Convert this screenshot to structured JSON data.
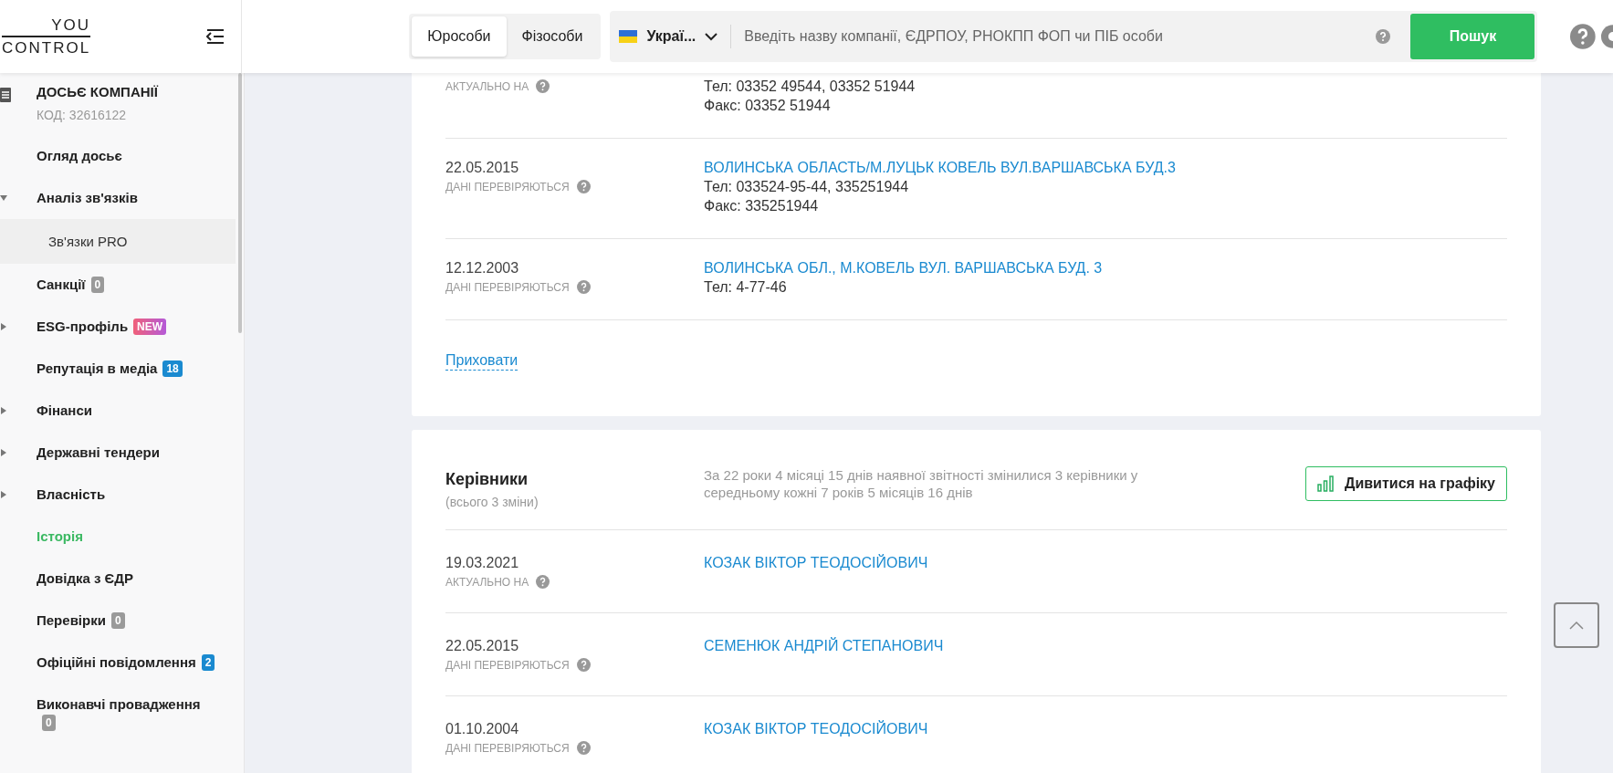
{
  "header": {
    "logo": {
      "top": "YOU",
      "bottom": "CONTROL"
    },
    "tabs": [
      {
        "label": "Юрособи",
        "selected": true
      },
      {
        "label": "Фізособи",
        "selected": false
      }
    ],
    "country": "Украї...",
    "search": {
      "placeholder": "Введіть назву компанії, ЄДРПОУ, РНОКПП ФОП чи ПІБ особи"
    },
    "search_button": "Пошук"
  },
  "sidebar": {
    "title": "ДОСЬЄ КОМПАНІЇ",
    "code": "КОД: 32616122",
    "items": [
      {
        "label": "Огляд досьє",
        "selected": false
      },
      {
        "label": "Аналіз зв'язків",
        "selected": false,
        "expanded": true,
        "children": [
          {
            "label": "Зв'язки PRO",
            "selected": false,
            "hovered": true
          }
        ]
      },
      {
        "label": "Санкції",
        "selected": false,
        "badge": {
          "text": "0",
          "kind": "neutral"
        }
      },
      {
        "label": "ESG-профіль",
        "selected": false,
        "expanded": false,
        "badge": {
          "text": "NEW",
          "kind": "new"
        }
      },
      {
        "label": "Репутація в медіа",
        "selected": false,
        "badge": {
          "text": "18",
          "kind": "info"
        }
      },
      {
        "label": "Фінанси",
        "selected": false,
        "expanded": false
      },
      {
        "label": "Державні тендери",
        "selected": false,
        "expanded": false
      },
      {
        "label": "Власність",
        "selected": false,
        "expanded": false
      },
      {
        "label": "Історія",
        "selected": true
      },
      {
        "label": "Довідка з ЄДР",
        "selected": false
      },
      {
        "label": "Перевірки",
        "selected": false,
        "badge": {
          "text": "0",
          "kind": "neutral"
        }
      },
      {
        "label": "Офіційні повідомлення",
        "selected": false,
        "badge": {
          "text": "2",
          "kind": "info"
        }
      },
      {
        "label": "Виконавчі провадження",
        "selected": false,
        "badge": {
          "text": "0",
          "kind": "neutral"
        }
      }
    ]
  },
  "addresses": {
    "rows": [
      {
        "status": "АКТУАЛЬНО НА",
        "lines": [
          "Тел: 03352 49544, 03352 51944",
          "Факс: 03352 51944"
        ]
      },
      {
        "date": "22.05.2015",
        "status": "ДАНІ ПЕРЕВІРЯЮТЬСЯ",
        "address": "ВОЛИНСЬКА ОБЛАСТЬ/М.ЛУЦЬК КОВЕЛЬ ВУЛ.ВАРШАВСЬКА БУД.3",
        "lines": [
          "Тел: 033524-95-44, 335251944",
          "Факс: 335251944"
        ]
      },
      {
        "date": "12.12.2003",
        "status": "ДАНІ ПЕРЕВІРЯЮТЬСЯ",
        "address": "ВОЛИНСЬКА ОБЛ., М.КОВЕЛЬ ВУЛ. ВАРШАВСЬКА БУД. 3",
        "lines": [
          "Тел: 4-77-46"
        ]
      }
    ],
    "hide_link": "Приховати"
  },
  "managers": {
    "title": "Керівники",
    "subtitle": "(всього 3 зміни)",
    "summary": "За 22 роки 4 місяці 15 днів наявної звітності змінилися 3 керівники у середньому кожні 7 років 5 місяців 16 днів",
    "chart_button": "Дивитися на графіку",
    "rows": [
      {
        "date": "19.03.2021",
        "status": "АКТУАЛЬНО НА",
        "name": "КОЗАК ВІКТОР ТЕОДОСІЙОВИЧ"
      },
      {
        "date": "22.05.2015",
        "status": "ДАНІ ПЕРЕВІРЯЮТЬСЯ",
        "name": "СЕМЕНЮК АНДРІЙ СТЕПАНОВИЧ"
      },
      {
        "date": "01.10.2004",
        "status": "ДАНІ ПЕРЕВІРЯЮТЬСЯ",
        "name": "КОЗАК ВІКТОР ТЕОДОСІЙОВИЧ"
      }
    ]
  }
}
